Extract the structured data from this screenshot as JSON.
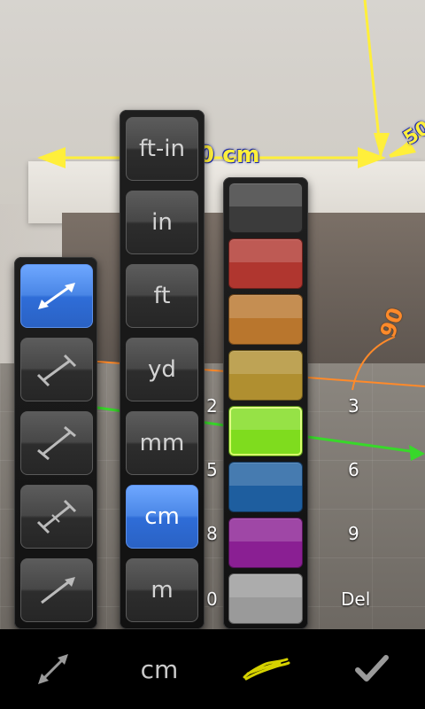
{
  "scene": {
    "measurements": {
      "top_length": "0 cm",
      "side_length": "50",
      "angle": "90"
    },
    "keypad_numbers": [
      "2",
      "3",
      "5",
      "6",
      "8",
      "9",
      "0",
      "Del"
    ]
  },
  "line_tools": {
    "items": [
      {
        "name": "line-tool-double-arrow",
        "active": true
      },
      {
        "name": "line-tool-bar-ends",
        "active": false
      },
      {
        "name": "line-tool-tick-ends",
        "active": false
      },
      {
        "name": "line-tool-cross-ends",
        "active": false
      },
      {
        "name": "line-tool-single-arrow",
        "active": false
      }
    ]
  },
  "units": {
    "items": [
      "ft-in",
      "in",
      "ft",
      "yd",
      "mm",
      "cm",
      "m"
    ],
    "selected": "cm"
  },
  "colors": {
    "items": [
      "#3b3b3b",
      "#b0362f",
      "#b9762d",
      "#b08f30",
      "#7fdc1e",
      "#1e5e9f",
      "#8a1f93",
      "#9a9a9a"
    ],
    "selected_index": 4
  },
  "bottom_bar": {
    "line_tool_icon": "double-arrow-icon",
    "unit_label": "cm",
    "color_icon": "yellow-scribble-icon",
    "confirm_icon": "checkmark-icon"
  }
}
